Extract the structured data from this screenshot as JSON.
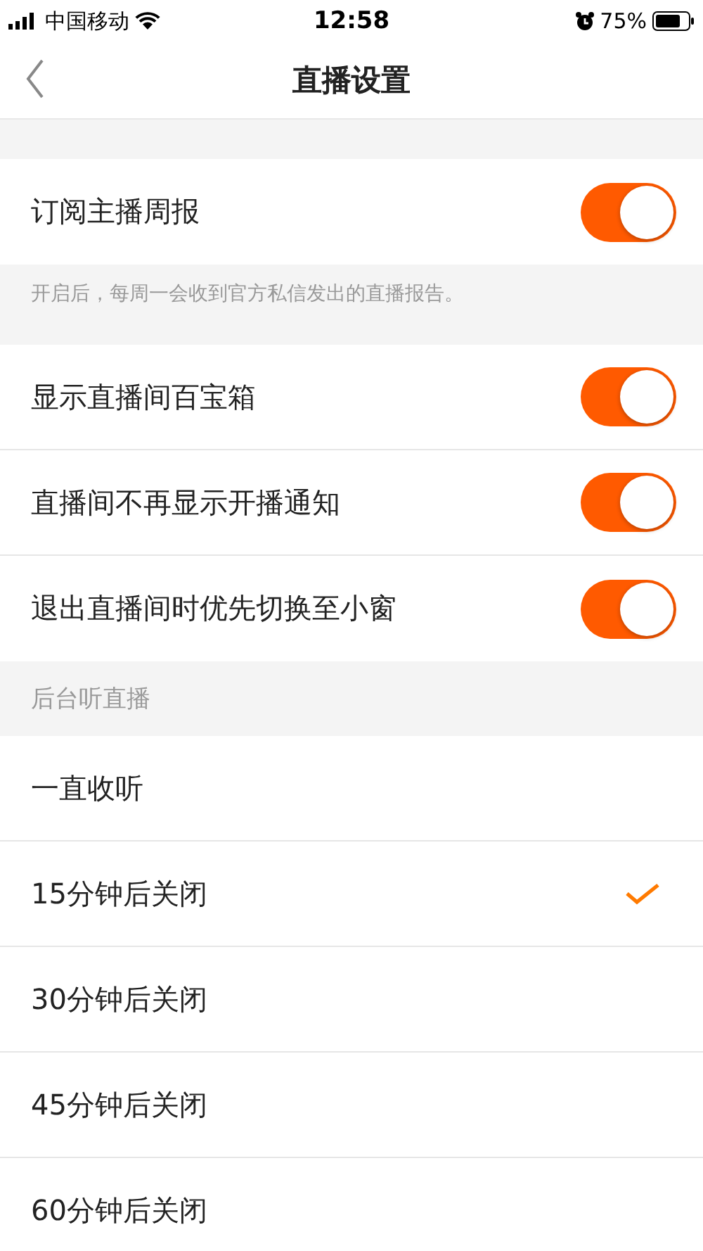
{
  "status_bar": {
    "carrier": "中国移动",
    "time": "12:58",
    "battery": "75%"
  },
  "nav": {
    "title": "直播设置"
  },
  "subscribe": {
    "label": "订阅主播周报",
    "on": true,
    "hint": "开启后，每周一会收到官方私信发出的直播报告。"
  },
  "toggles": [
    {
      "label": "显示直播间百宝箱",
      "on": true
    },
    {
      "label": "直播间不再显示开播通知",
      "on": true
    },
    {
      "label": "退出直播间时优先切换至小窗",
      "on": true
    }
  ],
  "background_section": {
    "title": "后台听直播",
    "options": [
      {
        "label": "一直收听",
        "selected": false
      },
      {
        "label": "15分钟后关闭",
        "selected": true
      },
      {
        "label": "30分钟后关闭",
        "selected": false
      },
      {
        "label": "45分钟后关闭",
        "selected": false
      },
      {
        "label": "60分钟后关闭",
        "selected": false
      }
    ]
  }
}
